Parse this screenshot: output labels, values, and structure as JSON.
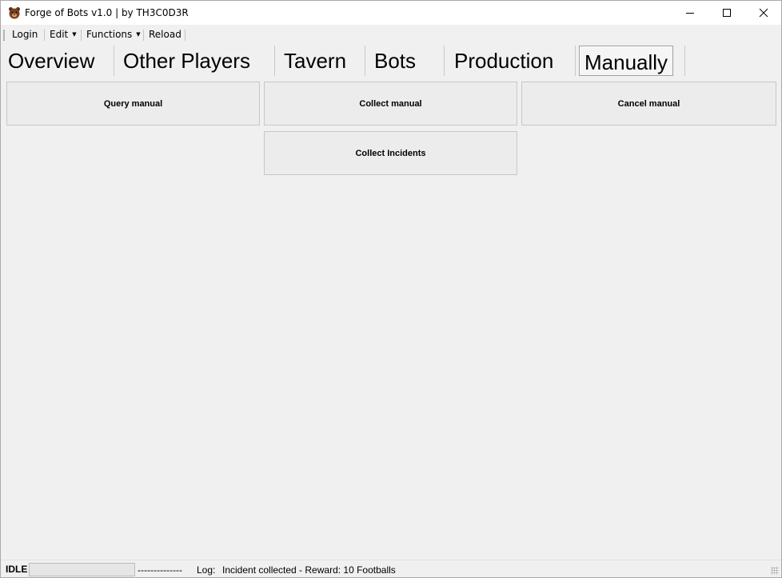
{
  "window": {
    "title": "Forge of Bots v1.0 | by TH3C0D3R",
    "icon": "bear-app-icon"
  },
  "menu": {
    "items": [
      "Login",
      "Edit",
      "Functions",
      "Reload"
    ]
  },
  "tabs": {
    "items": [
      "Overview",
      "Other Players",
      "Tavern",
      "Bots",
      "Production",
      "Manually"
    ],
    "selected": "Manually"
  },
  "buttons": {
    "query_manual": "Query manual",
    "collect_manual": "Collect manual",
    "cancel_manual": "Cancel manual",
    "collect_incidents": "Collect Incidents"
  },
  "status": {
    "state": "IDLE",
    "progress": 0,
    "divider": "--------------",
    "log_label": "Log:",
    "log_message": "Incident collected - Reward: 10 Footballs"
  },
  "colors": {
    "background": "#f0f0f0",
    "titlebar": "#ffffff",
    "button_face": "#ececec"
  }
}
